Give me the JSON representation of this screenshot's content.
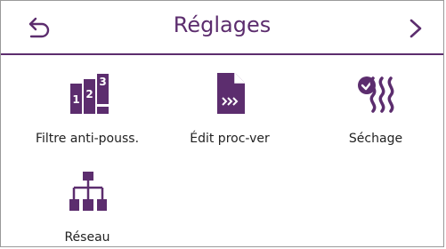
{
  "header": {
    "title": "Réglages",
    "back_icon": "back-arrow-icon",
    "next_icon": "chevron-right-icon"
  },
  "accent_color": "#5c2d6e",
  "tiles": [
    {
      "label": "Filtre anti-pouss.",
      "icon": "filter-icon"
    },
    {
      "label": "Édit proc-ver",
      "icon": "document-edit-icon"
    },
    {
      "label": "Séchage",
      "icon": "drying-icon"
    },
    {
      "label": "Réseau",
      "icon": "network-icon"
    }
  ]
}
